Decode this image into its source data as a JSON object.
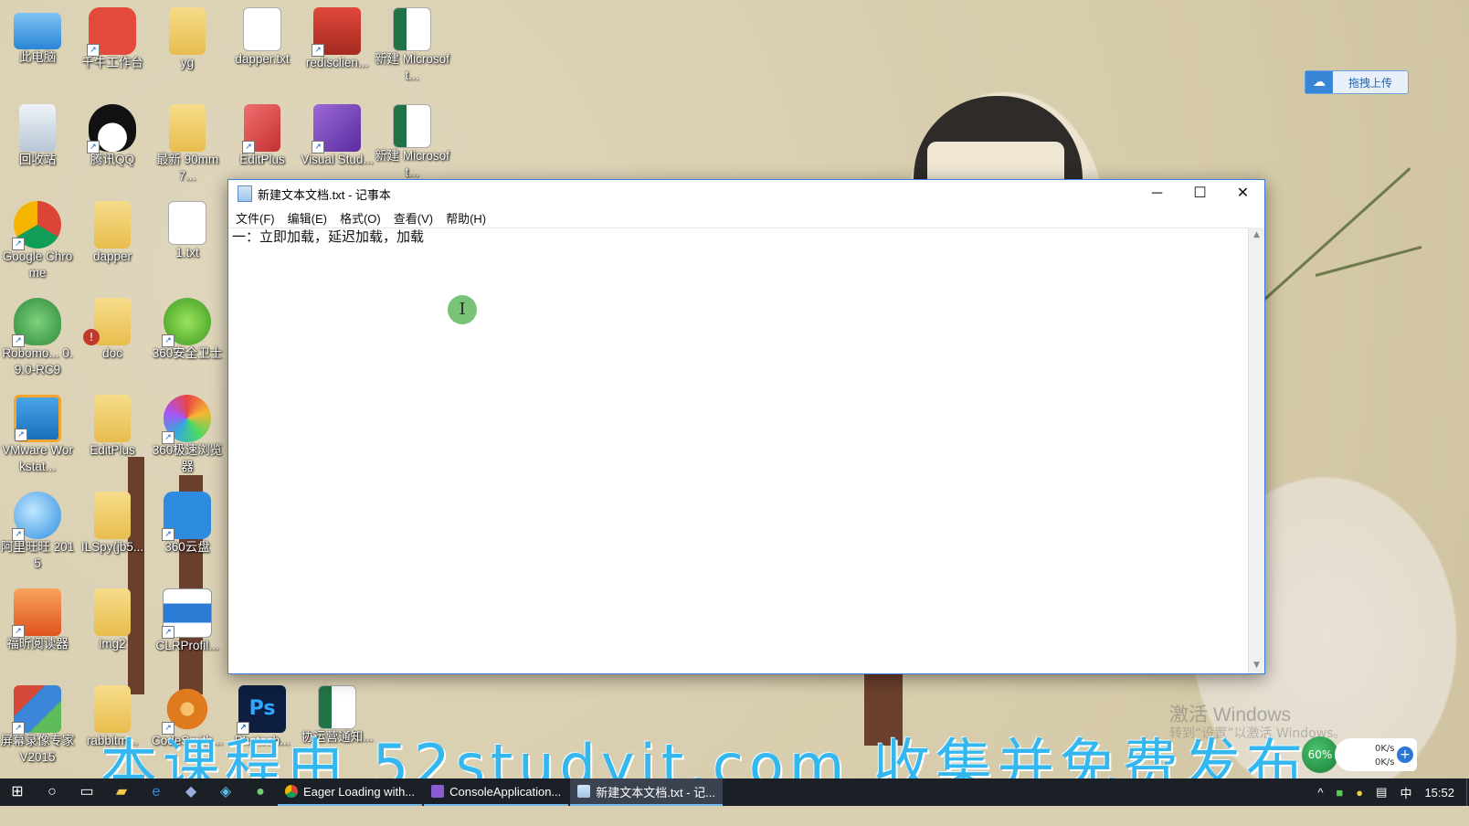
{
  "desktop": {
    "icons": [
      {
        "label": "此电脑",
        "icon": "computer-icon"
      },
      {
        "label": "千牛工作台",
        "icon": "qianniu-icon"
      },
      {
        "label": "yg",
        "icon": "folder-icon"
      },
      {
        "label": "dapper.txt",
        "icon": "text-file-icon"
      },
      {
        "label": "redisclien...",
        "icon": "redis-icon"
      },
      {
        "label": "新建 Microsoft...",
        "icon": "excel-icon"
      },
      {
        "label": "回收站",
        "icon": "recycle-bin-icon"
      },
      {
        "label": "腾讯QQ",
        "icon": "qq-icon"
      },
      {
        "label": "最新 90mm7...",
        "icon": "folder-icon"
      },
      {
        "label": "EditPlus",
        "icon": "editplus-icon"
      },
      {
        "label": "Visual Stud...",
        "icon": "visual-studio-icon"
      },
      {
        "label": "新建 Microsoft...",
        "icon": "excel-icon"
      },
      {
        "label": "Google Chrome",
        "icon": "chrome-icon"
      },
      {
        "label": "dapper",
        "icon": "folder-icon"
      },
      {
        "label": "1.txt",
        "icon": "text-file-icon"
      },
      {
        "label": "Robomo... 0.9.0-RC9",
        "icon": "robomongo-icon"
      },
      {
        "label": "doc",
        "icon": "folder-icon"
      },
      {
        "label": "360安全卫士",
        "icon": "360-security-icon"
      },
      {
        "label": "VMware Workstat...",
        "icon": "vmware-icon"
      },
      {
        "label": "EditPlus",
        "icon": "folder-icon"
      },
      {
        "label": "360极速浏览器",
        "icon": "360-browser-icon"
      },
      {
        "label": "阿里旺旺 2015",
        "icon": "aliwangwang-icon"
      },
      {
        "label": "ILSpy(jb5...",
        "icon": "folder-icon"
      },
      {
        "label": "360云盘",
        "icon": "360-cloud-icon"
      },
      {
        "label": "福昕阅读器",
        "icon": "foxit-pdf-icon"
      },
      {
        "label": "img2",
        "icon": "folder-icon"
      },
      {
        "label": "CLRProfil...",
        "icon": "clrprofiler-icon"
      },
      {
        "label": "屏幕录像专家V2015",
        "icon": "screen-recorder-icon"
      },
      {
        "label": "rabbitm...",
        "icon": "folder-icon"
      },
      {
        "label": "CodeSmith...",
        "icon": "codesmith-icon"
      },
      {
        "label": "Photosh...",
        "icon": "photoshop-icon"
      },
      {
        "label": "协运营通知...",
        "icon": "excel-icon"
      }
    ],
    "upload_widget": {
      "label": "拖拽上传",
      "icon": "cloud-upload-icon"
    },
    "activation": {
      "line1": "激活 Windows",
      "line2": "转到“设置”以激活 Windows。"
    },
    "netspeed": {
      "percent": "60%",
      "up": "0K/s",
      "down": "0K/s"
    },
    "watermark": "本课程由 52studyit.com 收集并免费发布"
  },
  "notepad": {
    "title": "新建文本文档.txt - 记事本",
    "menus": [
      "文件(F)",
      "编辑(E)",
      "格式(O)",
      "查看(V)",
      "帮助(H)"
    ],
    "content": "一：立即加载，延迟加载，加载",
    "window_buttons": {
      "minimize": "─",
      "maximize": "☐",
      "close": "✕"
    }
  },
  "taskbar": {
    "tasks": [
      {
        "label": "Eager Loading with...",
        "icon": "chrome-icon",
        "active": false
      },
      {
        "label": "ConsoleApplication...",
        "icon": "visual-studio-icon",
        "active": false
      },
      {
        "label": "新建文本文档.txt - 记...",
        "icon": "notepad-icon",
        "active": true
      }
    ],
    "ime": "中",
    "clock": "15:52"
  }
}
